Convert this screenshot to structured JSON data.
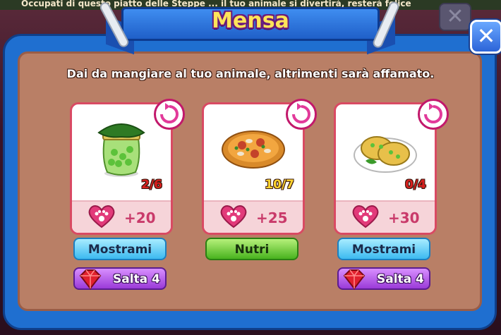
{
  "top_strip_text": "Occupati di questo piatto delle Steppe ... il tuo animale si divertirà, resterà felice",
  "title": "Mensa",
  "subtitle": "Dai da mangiare al tuo animale, altrimenti sarà affamato.",
  "close_label": "✕",
  "colors": {
    "panel": "#1f6fd0",
    "panel_inner": "#b97f66",
    "title": "#ffe45a",
    "count_bad": "#d8201e",
    "count_good": "#ffd430"
  },
  "cards": [
    {
      "food_icon": "pea-jar-icon",
      "count": "2/6",
      "count_status": "bad",
      "bonus": "+20",
      "action_label": "Mostrami",
      "skip_label": "Salta 4"
    },
    {
      "food_icon": "pizza-icon",
      "count": "10/7",
      "count_status": "good",
      "bonus": "+25",
      "action_label": "Nutri",
      "skip_label": ""
    },
    {
      "food_icon": "pea-cakes-icon",
      "count": "0/4",
      "count_status": "bad",
      "bonus": "+30",
      "action_label": "Mostrami",
      "skip_label": "Salta 4"
    }
  ]
}
